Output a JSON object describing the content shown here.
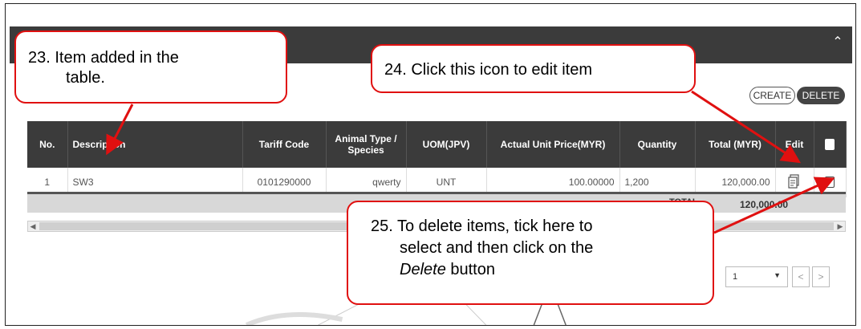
{
  "buttons": {
    "create": "CREATE",
    "delete": "DELETE"
  },
  "icons": {
    "collapse": "chevron-up-icon",
    "edit": "edit-document-icon"
  },
  "table": {
    "headers": [
      "No.",
      "Description",
      "Tariff Code",
      "Animal Type / Species",
      "UOM(JPV)",
      "Actual Unit Price(MYR)",
      "Quantity",
      "Total (MYR)",
      "Edit"
    ],
    "rows": [
      {
        "no": "1",
        "description": "SW3",
        "tariff_code": "0101290000",
        "animal_type": "qwerty",
        "uom": "UNT",
        "unit_price": "100.00000",
        "quantity": "1,200",
        "total": "120,000.00"
      }
    ],
    "total_label": "TOTAL",
    "total_value": "120,000.00"
  },
  "pagination": {
    "selected_page": "1",
    "prev": "<",
    "next": ">"
  },
  "annotations": {
    "c23_line1": "23.  Item added in the",
    "c23_line2": "table.",
    "c24": "24.  Click this icon to edit item",
    "c25_line1": "25. To delete items, tick here to",
    "c25_line2": "select and then click on the",
    "c25_line3_italic": "Delete",
    "c25_line3_rest": " button"
  },
  "colors": {
    "callout_border": "#e01010",
    "header_bg": "#3b3b3b"
  }
}
